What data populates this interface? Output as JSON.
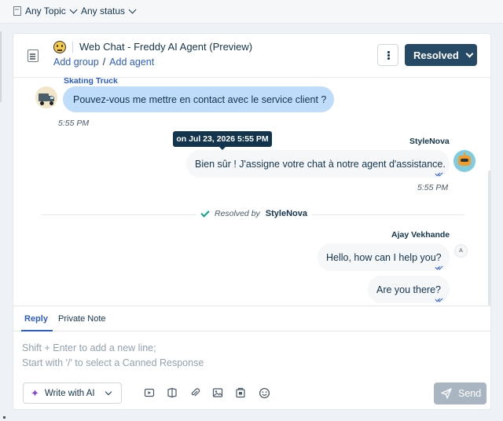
{
  "filters": {
    "topic": "Any Topic",
    "status": "Any status"
  },
  "header": {
    "title": "Web Chat - Freddy AI Agent (Preview)",
    "add_group": "Add group",
    "separator": "/",
    "add_agent": "Add agent",
    "status_button": "Resolved"
  },
  "messages": {
    "customer": {
      "name": "Skating Truck",
      "text": "Pouvez-vous me mettre en contact avec le service client ?",
      "time": "5:55 PM"
    },
    "tooltip": "on Jul 23, 2026 5:55 PM",
    "bot": {
      "name": "StyleNova",
      "text": "Bien sûr ! J'assigne votre chat à notre agent d'assistance.",
      "time": "5:55 PM"
    },
    "resolved": {
      "label": "Resolved by",
      "by": "StyleNova"
    },
    "agent": {
      "name": "Ajay Vekhande",
      "avatar_initial": "A",
      "msg1": "Hello, how can I help you?",
      "msg2": "Are you there?"
    }
  },
  "reply": {
    "tab_reply": "Reply",
    "tab_private": "Private Note",
    "placeholder_line1": "Shift + Enter to add a new line;",
    "placeholder_line2": "Start with '/' to select a Canned Response",
    "write_ai": "Write with AI",
    "send": "Send"
  },
  "colors": {
    "accent": "#2c5cc5",
    "primary_button": "#264966",
    "customer_bubble": "#bfdcfb",
    "send_disabled": "#a9b6c2"
  }
}
